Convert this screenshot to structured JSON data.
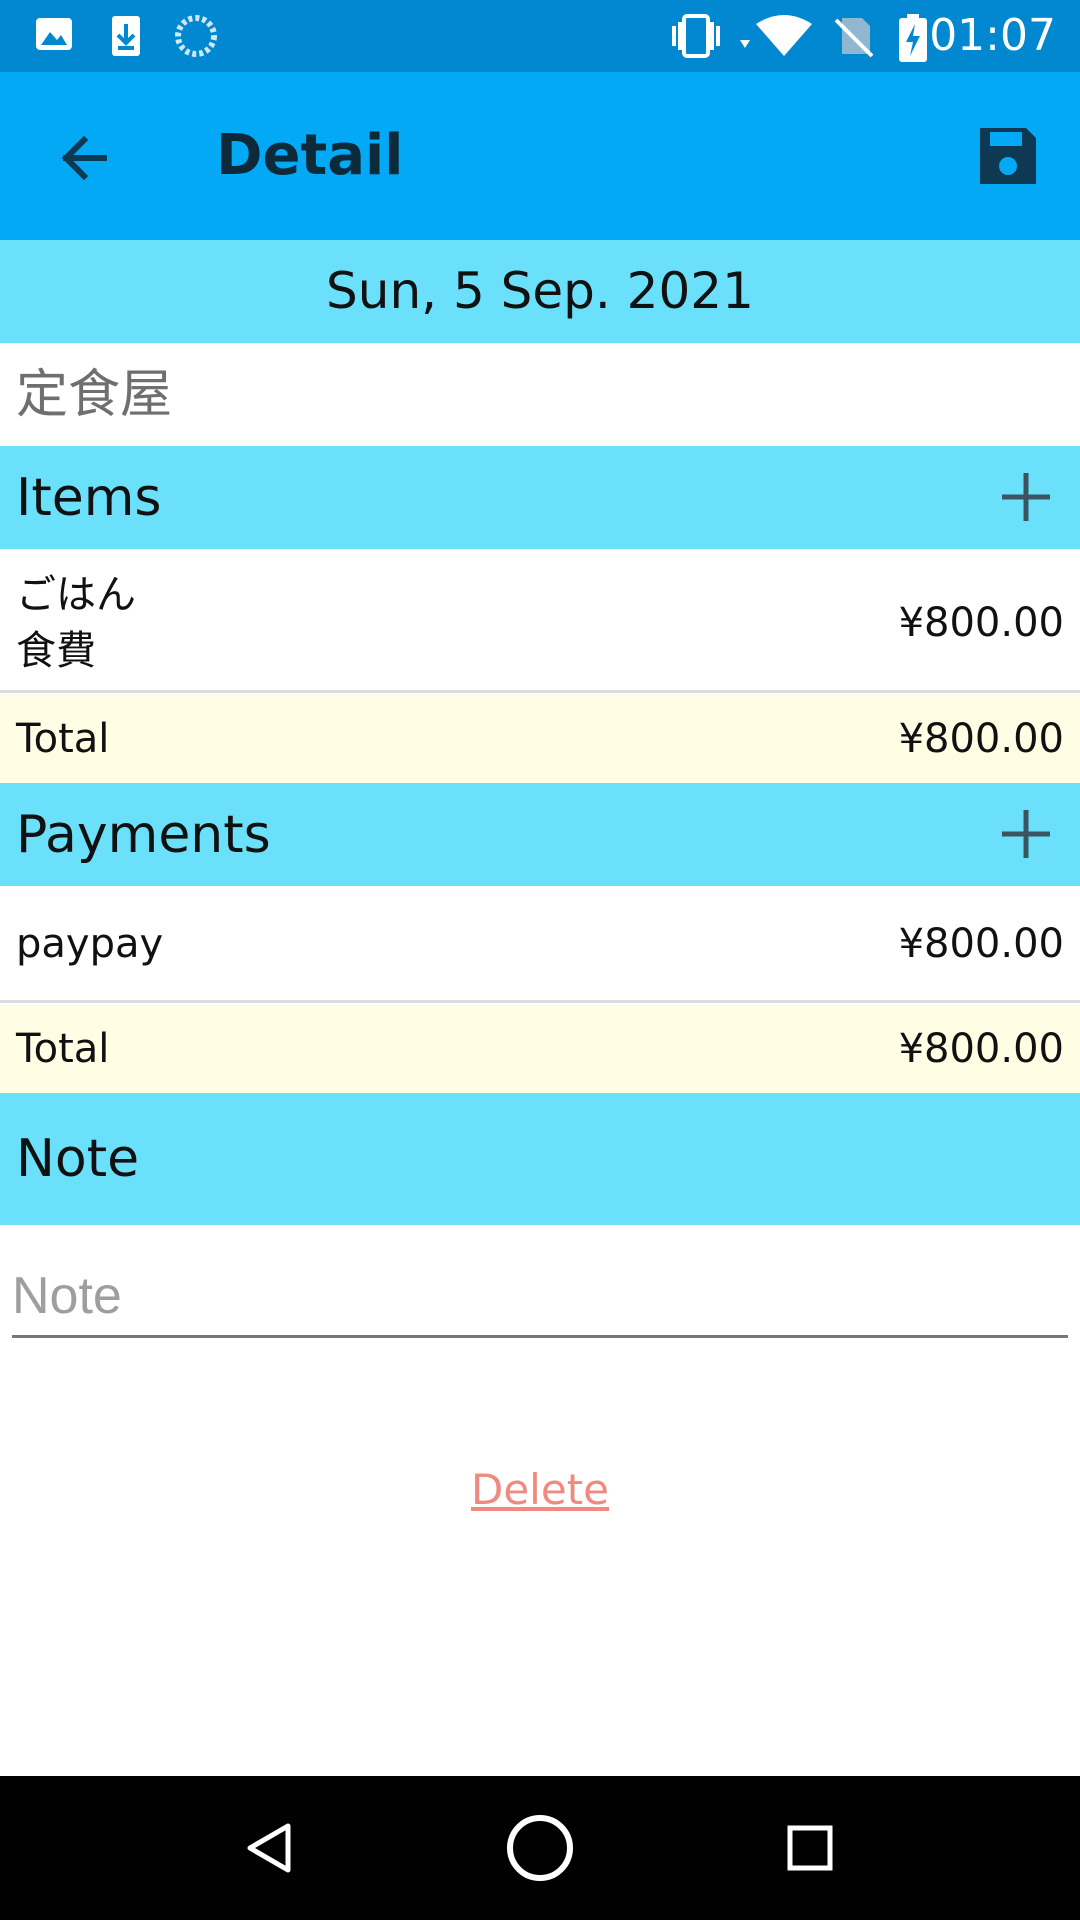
{
  "status_bar": {
    "time": "01:07",
    "icons": [
      "image-icon",
      "download-icon",
      "loading-icon",
      "vibrate-icon",
      "wifi-icon",
      "no-sim-icon",
      "battery-charging-icon"
    ]
  },
  "app_bar": {
    "title": "Detail",
    "back_icon": "arrow-back-icon",
    "save_icon": "save-icon"
  },
  "date": "Sun, 5 Sep. 2021",
  "shop": {
    "name": "定食屋"
  },
  "items_section": {
    "title": "Items",
    "items": [
      {
        "name": "ごはん",
        "category": "食費",
        "amount": "¥800.00"
      }
    ],
    "total_label": "Total",
    "total_amount": "¥800.00"
  },
  "payments_section": {
    "title": "Payments",
    "payments": [
      {
        "name": "paypay",
        "amount": "¥800.00"
      }
    ],
    "total_label": "Total",
    "total_amount": "¥800.00"
  },
  "note_section": {
    "title": "Note",
    "value": "",
    "placeholder": "Note"
  },
  "delete_label": "Delete",
  "colors": {
    "status_bar": "#0288d1",
    "app_bar": "#03a9f4",
    "section_header": "#6be0fb",
    "total_row": "#fffde4",
    "delete": "#f08a80"
  }
}
